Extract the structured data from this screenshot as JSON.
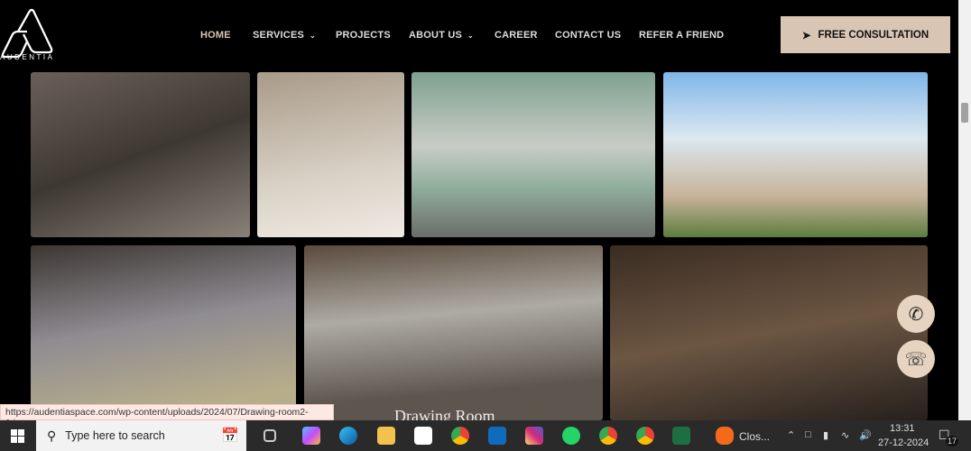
{
  "header": {
    "logo_text": "AUDENTIA",
    "nav": [
      {
        "label": "HOME"
      },
      {
        "label": "SERVICES",
        "dropdown": true
      },
      {
        "label": "PROJECTS"
      },
      {
        "label": "ABOUT US",
        "dropdown": true
      },
      {
        "label": "CAREER"
      },
      {
        "label": "CONTACT US"
      },
      {
        "label": "REFER A FRIEND"
      }
    ],
    "cta": "FREE CONSULTATION"
  },
  "gallery": {
    "caption": "Drawing Room"
  },
  "status_url": "https://audentiaspace.com/wp-content/uploads/2024/07/Drawing-room2-1.jpeg",
  "taskbar": {
    "search_placeholder": "Type here to search",
    "app_label": "Clos...",
    "time": "13:31",
    "date": "27-12-2024",
    "notifications": "17"
  },
  "colors": {
    "accent": "#d9c5b4"
  }
}
